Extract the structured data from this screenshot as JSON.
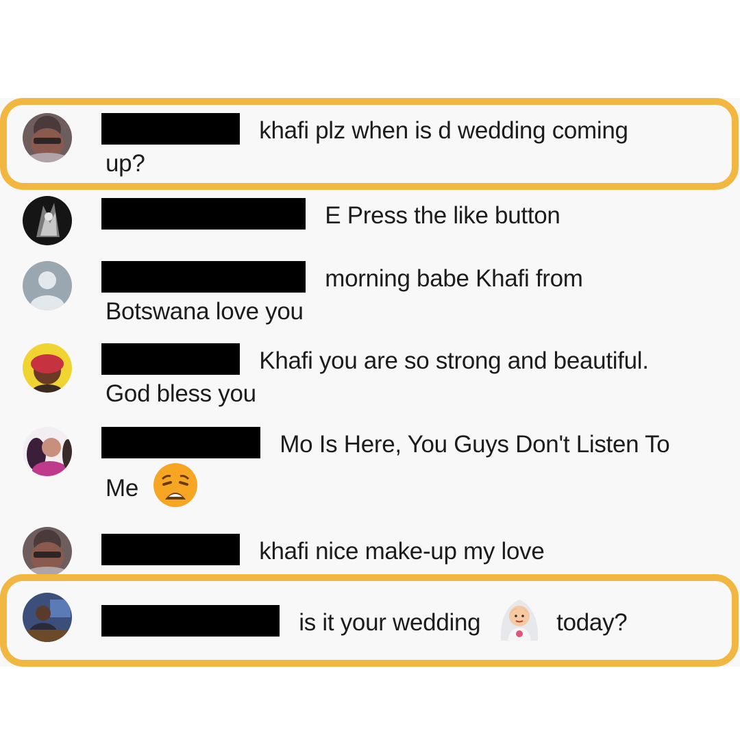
{
  "comments": [
    {
      "text_before": "khafi plz when is d wedding coming",
      "text_after": "up?"
    },
    {
      "text_before": "E Press the like button"
    },
    {
      "text_before": "morning babe Khafi from",
      "text_after": "Botswana love you"
    },
    {
      "text_before": "Khafi you are so strong and beautiful.",
      "text_after": "God bless you"
    },
    {
      "text_before": "Mo Is Here, You Guys Don't Listen To",
      "text_after": "Me",
      "emoji": "weary-face-emoji"
    },
    {
      "text_before": "khafi nice make-up my love"
    },
    {
      "text_before": "is it your wedding",
      "text_after": "today?",
      "emoji": "bride-with-veil-emoji"
    }
  ],
  "colors": {
    "highlight": "#f2b740",
    "panel_background": "#f8f8f8",
    "redaction": "#000000"
  }
}
